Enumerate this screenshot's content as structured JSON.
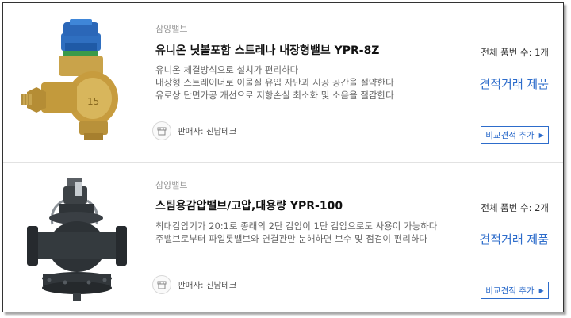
{
  "products": [
    {
      "brand": "삼양밸브",
      "title": "유니온 닛볼포함 스트레나 내장형밸브 YPR-8Z",
      "description": [
        "유니온 체결방식으로 설치가 편리하다",
        "내장형 스트레이너로 이물질 유입 자단과 시공 공간을 절약한다",
        "유로상 단면가공 개선으로 저항손실 최소화 및 소음을 절감한다"
      ],
      "seller": "판매사: 진남테크",
      "count": "전체 품번 수: 1개",
      "quote_label": "견적거래 제품",
      "compare_label": "비교견적 추가",
      "image_icon": "brass-pressure-reducing-valve"
    },
    {
      "brand": "삼양밸브",
      "title": "스팀용감압밸브/고압,대용량 YPR-100",
      "description": [
        "최대감압기가 20:1로 종래의 2단 감압이 1단 감압으로도 사용이 가능하다",
        "주밸브로부터 파일롯밸브와 연결관만 분해하면 보수 및 점검이 편리하다"
      ],
      "seller": "판매사: 진남테크",
      "count": "전체 품번 수: 2개",
      "quote_label": "견적거래 제품",
      "compare_label": "비교견적 추가",
      "image_icon": "steam-pressure-reducing-valve"
    }
  ],
  "colors": {
    "accent": "#2d6ccb",
    "muted": "#9a9a9a",
    "border": "#333333"
  }
}
